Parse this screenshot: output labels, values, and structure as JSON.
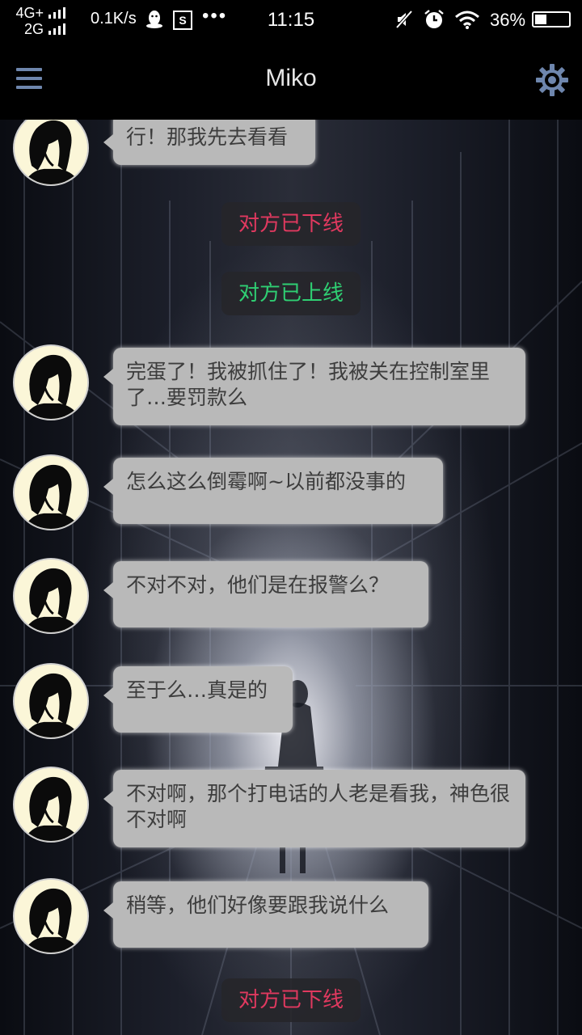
{
  "status_bar": {
    "network_top": "4G+",
    "network_bottom": "2G",
    "speed": "0.1K/s",
    "s_icon_label": "S",
    "more_dots": "•••",
    "time": "11:15",
    "battery_percent": "36%",
    "battery_level": 0.36
  },
  "header": {
    "title": "Miko",
    "menu_icon": "hamburger-menu-icon",
    "settings_icon": "gear-icon",
    "icon_color": "#6e86ad"
  },
  "colors": {
    "offline": "#e0395f",
    "online": "#2fcf73",
    "bubble_bg": "#b9b9b9",
    "bubble_text": "#3d3d3d"
  },
  "messages": [
    {
      "kind": "bubble",
      "text": "行！那我先去看看"
    },
    {
      "kind": "system",
      "status": "offline",
      "text": "对方已下线"
    },
    {
      "kind": "system",
      "status": "online",
      "text": "对方已上线"
    },
    {
      "kind": "bubble",
      "text": "完蛋了！我被抓住了！我被关在控制室里了…要罚款么"
    },
    {
      "kind": "bubble",
      "text": "怎么这么倒霉啊~以前都没事的"
    },
    {
      "kind": "bubble",
      "text": "不对不对，他们是在报警么？"
    },
    {
      "kind": "bubble",
      "text": "至于么…真是的"
    },
    {
      "kind": "bubble",
      "text": "不对啊，那个打电话的人老是看我，神色很不对啊"
    },
    {
      "kind": "bubble",
      "text": "稍等，他们好像要跟我说什么"
    },
    {
      "kind": "system",
      "status": "offline",
      "text": "对方已下线"
    }
  ]
}
